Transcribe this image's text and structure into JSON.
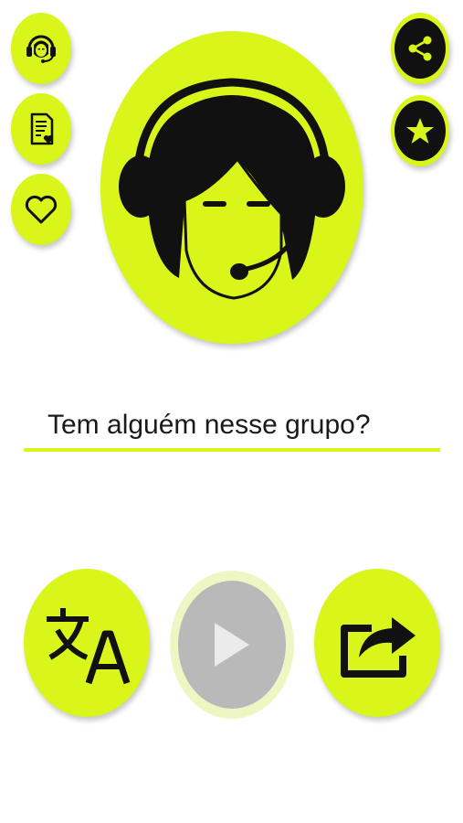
{
  "colors": {
    "accent": "#d9f51a",
    "dark": "#111111",
    "disabled": "#b9b9b9",
    "text": "#1a1a1a"
  },
  "left_buttons": [
    {
      "name": "support-agent",
      "icon": "headset-agent-icon"
    },
    {
      "name": "favorite-list",
      "icon": "document-heart-icon"
    },
    {
      "name": "favorite",
      "icon": "heart-icon"
    }
  ],
  "right_buttons": [
    {
      "name": "share",
      "icon": "share-icon"
    },
    {
      "name": "rate",
      "icon": "star-icon"
    }
  ],
  "avatar": {
    "icon": "headset-woman-icon"
  },
  "phrase": {
    "text": "Tem alguém nesse grupo?"
  },
  "bottom_controls": [
    {
      "name": "translate",
      "icon": "translate-icon",
      "enabled": true
    },
    {
      "name": "play",
      "icon": "play-icon",
      "enabled": false
    },
    {
      "name": "share-out",
      "icon": "share-out-icon",
      "enabled": true
    }
  ]
}
